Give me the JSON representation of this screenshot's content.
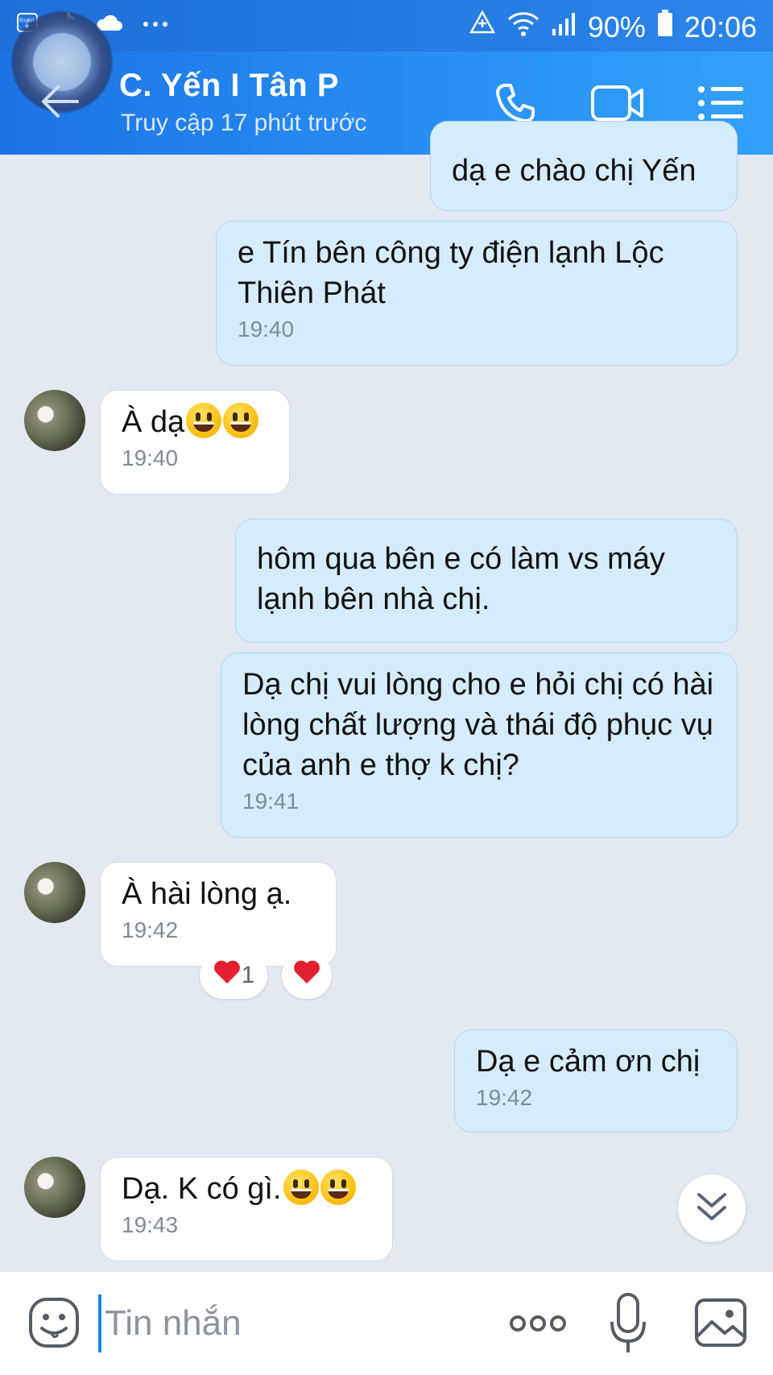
{
  "status_bar": {
    "battery": "90%",
    "time": "20:06",
    "left_icons": [
      "english-keyboard-icon",
      "tiktok-icon",
      "cloud-icon",
      "more-dots-icon"
    ],
    "right_icons": [
      "data-saver-icon",
      "wifi-icon",
      "signal-icon",
      "battery-icon"
    ]
  },
  "header": {
    "contact_name": "C. Yến I Tân P",
    "last_seen": "Truy cập 17 phút trước",
    "actions": [
      "phone-icon",
      "video-call-icon",
      "menu-icon"
    ]
  },
  "messages": [
    {
      "side": "out",
      "text": "dạ e chào chị Yến",
      "time": ""
    },
    {
      "side": "out",
      "text": "e Tín bên công ty điện lạnh Lộc Thiên Phát",
      "time": "19:40"
    },
    {
      "side": "in",
      "text": "À dạ",
      "emoji_count": 2,
      "time": "19:40"
    },
    {
      "side": "out",
      "text": "hôm qua bên e có làm vs máy lạnh bên nhà chị.",
      "time": ""
    },
    {
      "side": "out",
      "text": "Dạ chị vui lòng cho e hỏi chị có hài lòng chất lượng và thái độ phục vụ của anh e thợ k chị?",
      "time": "19:41"
    },
    {
      "side": "in",
      "text": "À hài lòng ạ.",
      "time": "19:42",
      "reaction_count": "1"
    },
    {
      "side": "out",
      "text": "Dạ e cảm ơn chị",
      "time": "19:42"
    },
    {
      "side": "in",
      "text": "Dạ. K có gì.",
      "emoji_count": 2,
      "time": "19:43"
    }
  ],
  "input_bar": {
    "placeholder": "Tin nhắn",
    "value": "",
    "icons": [
      "sticker-icon",
      "more-options-icon",
      "microphone-icon",
      "image-icon"
    ]
  },
  "colors": {
    "header": "#2b8cf0",
    "out_bubble": "#d5ecfd",
    "in_bubble": "#ffffff",
    "background": "#e2e9f1",
    "heart": "#e3202e"
  }
}
